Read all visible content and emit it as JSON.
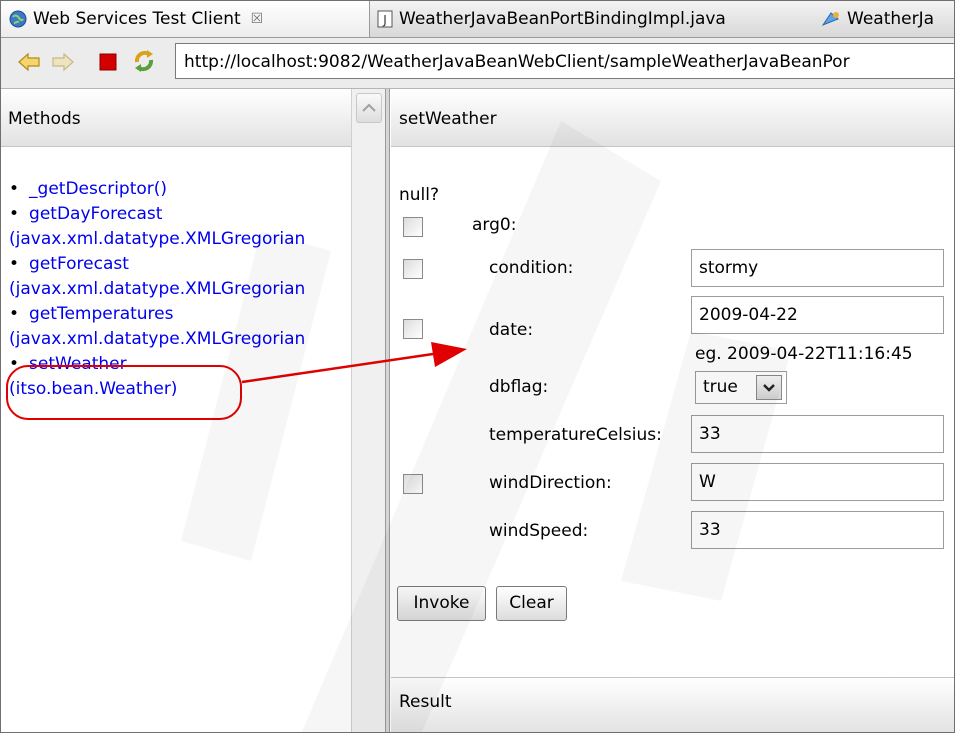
{
  "tabs": [
    {
      "label": "Web Services Test Client",
      "close": "☒"
    },
    {
      "label": "WeatherJavaBeanPortBindingImpl.java"
    },
    {
      "label": "WeatherJa"
    }
  ],
  "toolbar": {
    "url": "http://localhost:9082/WeatherJavaBeanWebClient/sampleWeatherJavaBeanPor"
  },
  "left_pane": {
    "header": "Methods",
    "methods": [
      {
        "name": "_getDescriptor()",
        "params": ""
      },
      {
        "name": "getDayForecast",
        "params": "(javax.xml.datatype.XMLGregorian"
      },
      {
        "name": "getForecast",
        "params": "(javax.xml.datatype.XMLGregorian"
      },
      {
        "name": "getTemperatures",
        "params": "(javax.xml.datatype.XMLGregorian"
      },
      {
        "name": "setWeather",
        "params": "(itso.bean.Weather)"
      }
    ]
  },
  "right_pane": {
    "header": "setWeather",
    "null_label": "null?",
    "arg_label": "arg0:",
    "fields": {
      "condition": {
        "label": "condition:",
        "value": "stormy"
      },
      "date": {
        "label": "date:",
        "value": "2009-04-22",
        "hint": "eg. 2009-04-22T11:16:45"
      },
      "dbflag": {
        "label": "dbflag:",
        "value": "true"
      },
      "temperatureCelsius": {
        "label": "temperatureCelsius:",
        "value": "33"
      },
      "windDirection": {
        "label": "windDirection:",
        "value": "W"
      },
      "windSpeed": {
        "label": "windSpeed:",
        "value": "33"
      }
    },
    "buttons": {
      "invoke": "Invoke",
      "clear": "Clear"
    },
    "result_header": "Result"
  },
  "colors": {
    "link": "#0000ee",
    "annotation": "#e00000",
    "stop": "#d40000"
  }
}
